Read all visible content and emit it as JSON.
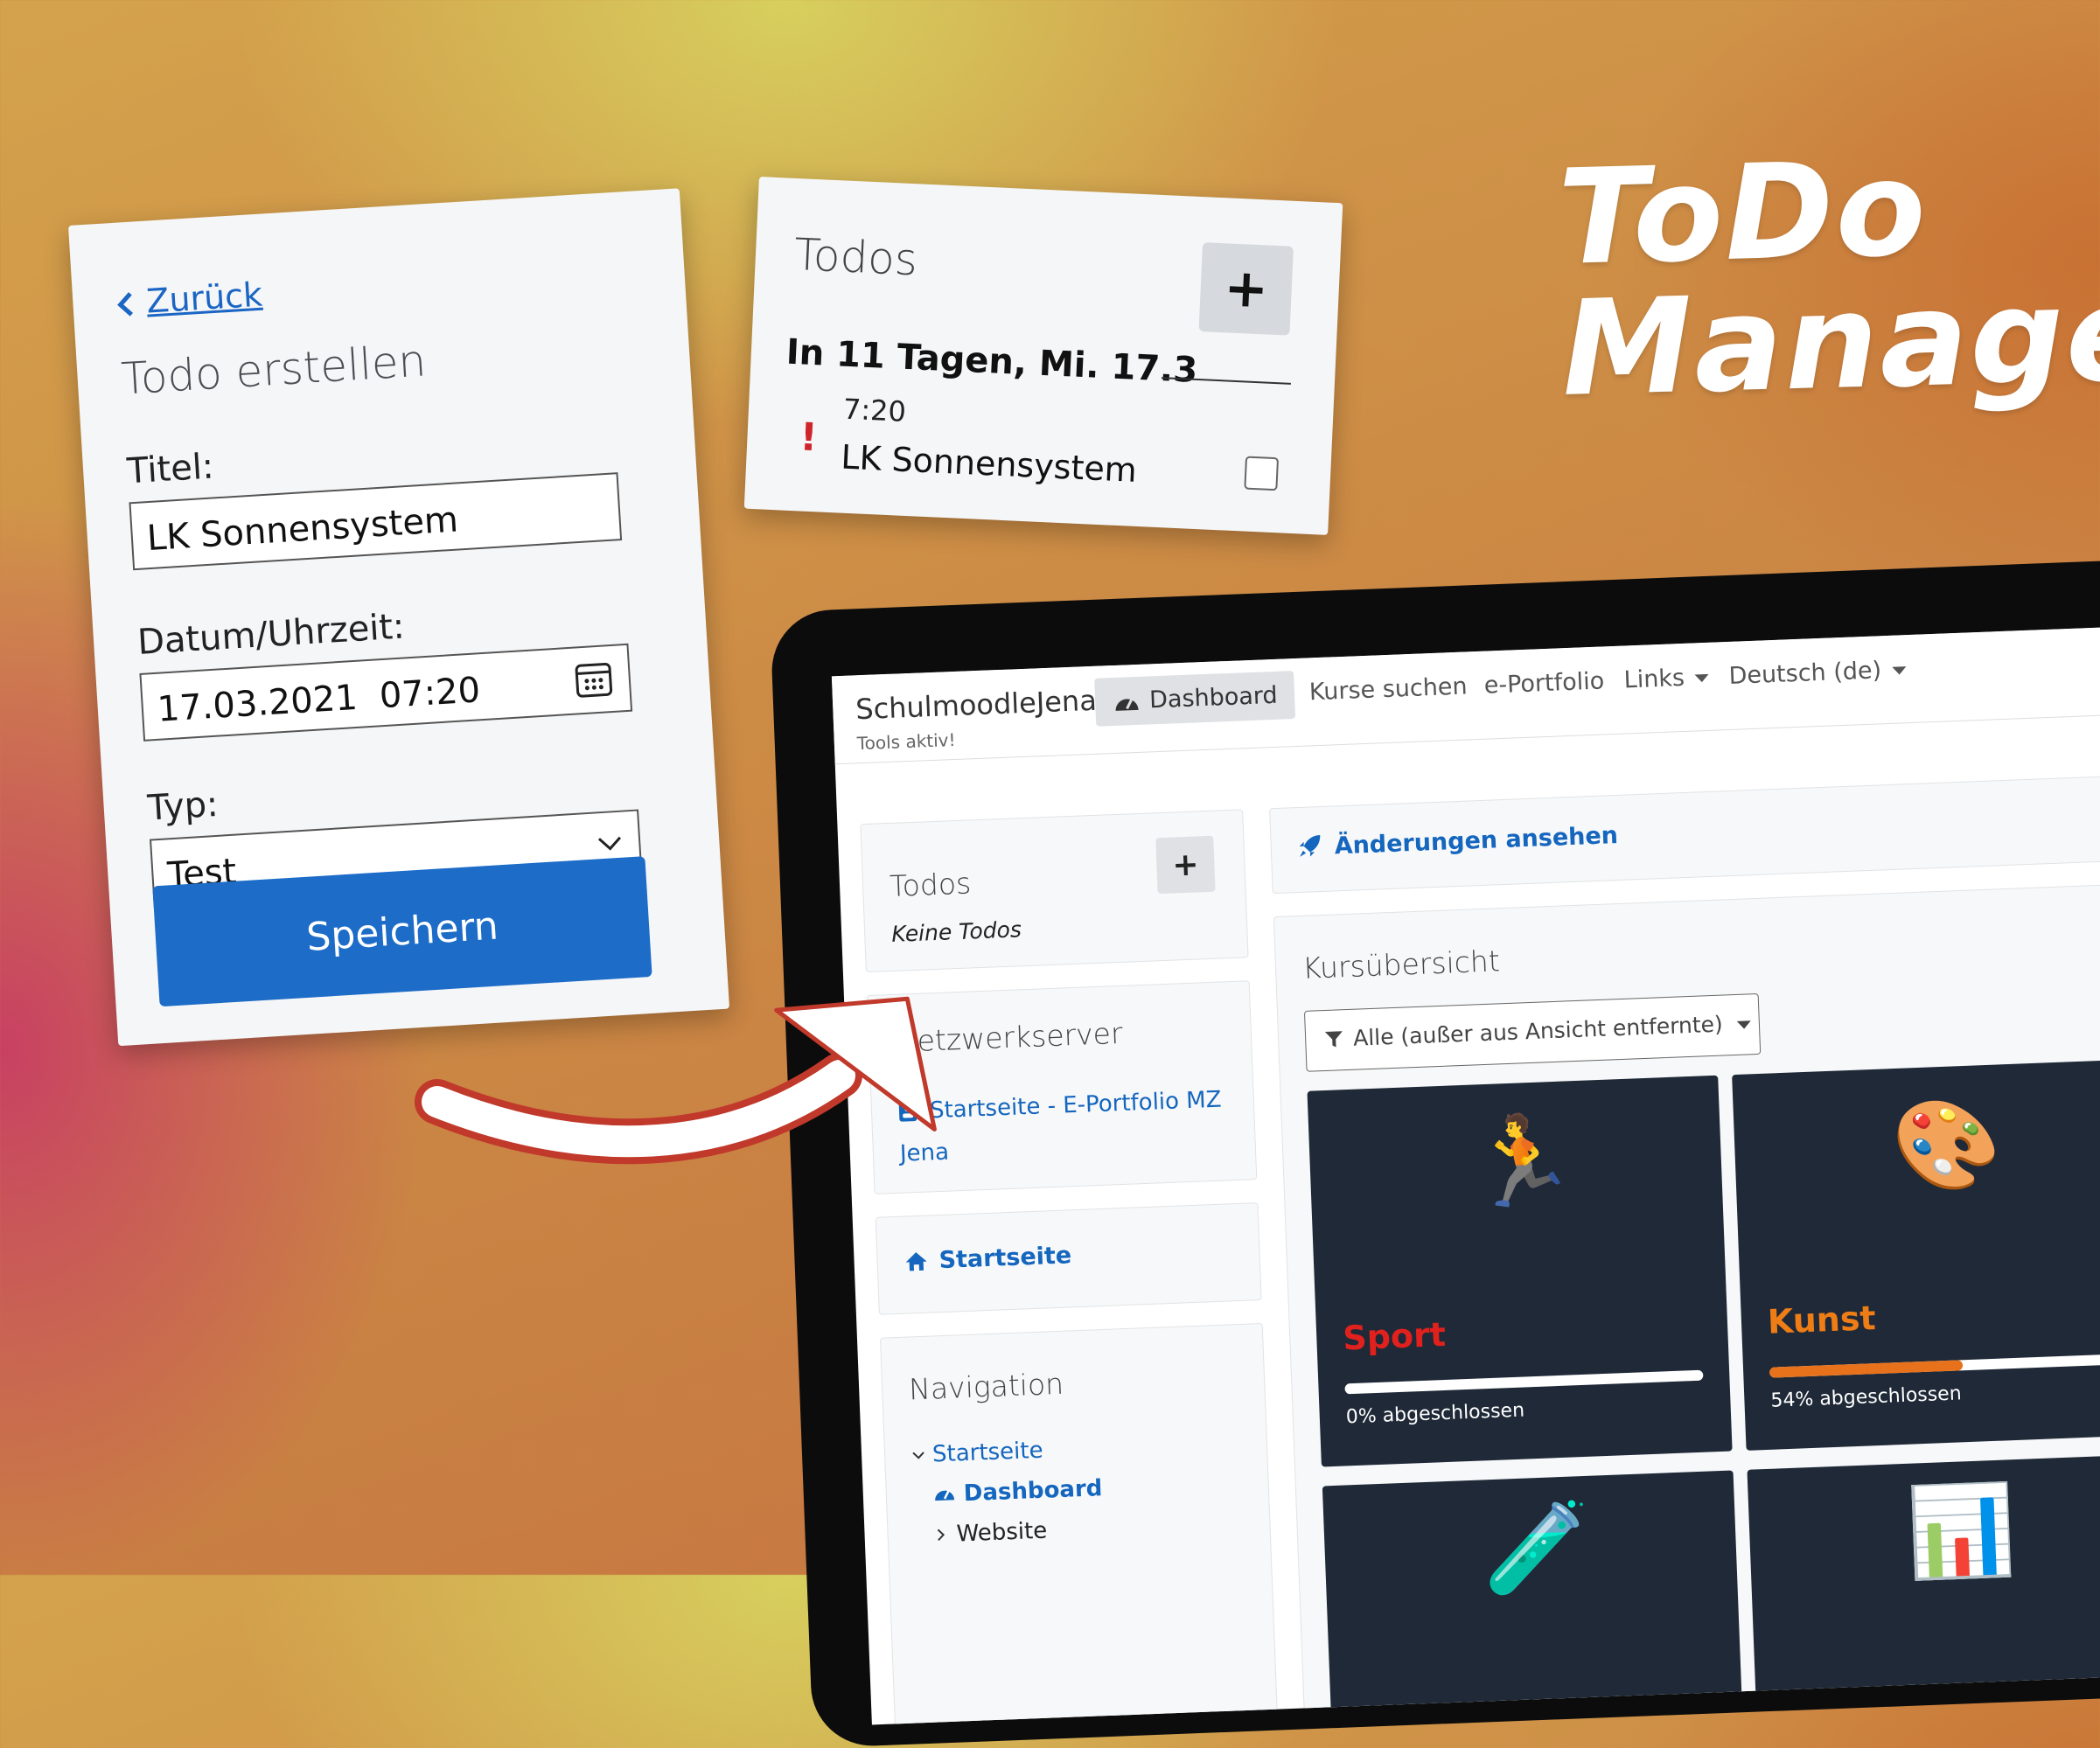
{
  "form": {
    "back_label": "Zurück",
    "heading": "Todo erstellen",
    "title_label": "Titel:",
    "title_value": "LK Sonnensystem",
    "datetime_label": "Datum/Uhrzeit:",
    "datetime_value": "17.03.2021  07:20",
    "type_label": "Typ:",
    "type_value": "Test",
    "save_label": "Speichern"
  },
  "todo_card": {
    "heading": "Todos",
    "add_label": "+",
    "day_header": "In 11 Tagen, Mi. 17.3",
    "items": [
      {
        "priority_mark": "!",
        "time": "7:20",
        "name": "LK Sonnensystem"
      }
    ]
  },
  "banner": {
    "line1": "ToDo",
    "line2": "Manager"
  },
  "moodle": {
    "brand": "SchulmoodleJena",
    "brand_sub": "Tools aktiv!",
    "nav": {
      "dashboard": "Dashboard",
      "kurse": "Kurse suchen",
      "eportfolio": "e-Portfolio",
      "links": "Links",
      "language": "Deutsch (de)"
    },
    "todos_block": {
      "heading": "Todos",
      "add_label": "+",
      "empty": "Keine Todos"
    },
    "netzwerk_block": {
      "heading": "Netzwerkserver",
      "link_line1": "Startseite - E-Portfolio MZ",
      "link_line2": "Jena"
    },
    "startseite_block": {
      "label": "Startseite"
    },
    "navigation_block": {
      "heading": "Navigation",
      "items": [
        "Startseite",
        "Dashboard",
        "Website"
      ]
    },
    "changes": {
      "label": "Änderungen ansehen"
    },
    "courses": {
      "heading": "Kursübersicht",
      "filter": "Alle (außer aus Ansicht entfernte)",
      "cards": [
        {
          "name": "Sport",
          "color": "#e0211d",
          "progress": 0,
          "progress_text": "0% abgeschlossen",
          "icon": "runner-emoji"
        },
        {
          "name": "Kunst",
          "color": "#ef7d16",
          "progress": 0.54,
          "progress_text": "54% abgeschlossen",
          "icon": "palette-emoji"
        }
      ]
    }
  }
}
